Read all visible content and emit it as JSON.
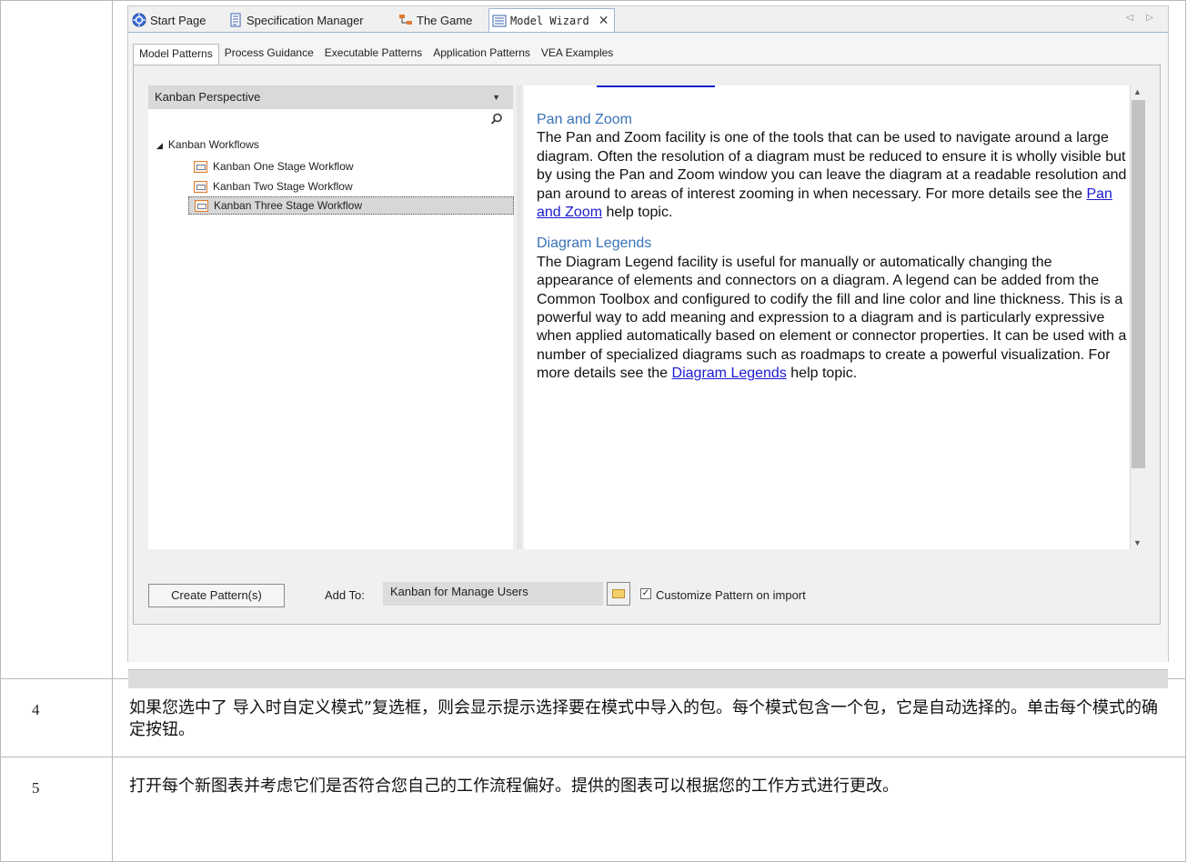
{
  "tabs": [
    {
      "label": "Start Page",
      "icon": "start-page-icon"
    },
    {
      "label": "Specification Manager",
      "icon": "specification-icon"
    },
    {
      "label": "The Game",
      "icon": "diagram-icon"
    },
    {
      "label": "Model Wizard",
      "icon": "model-wizard-icon",
      "active": true
    }
  ],
  "subtabs": [
    "Model Patterns",
    "Process Guidance",
    "Executable Patterns",
    "Application Patterns",
    "VEA Examples"
  ],
  "perspective": "Kanban Perspective",
  "tree": {
    "root": "Kanban Workflows",
    "items": [
      "Kanban One Stage Workflow",
      "Kanban Two Stage Workflow",
      "Kanban Three Stage Workflow"
    ],
    "selected_index": 2
  },
  "help": {
    "pan_title": "Pan and Zoom",
    "pan_text_1": "The Pan and Zoom facility is one of the tools that can be used to navigate around a large diagram. Often the resolution of a diagram must be reduced to ensure it is wholly visible but by using the Pan and Zoom window you can leave the diagram at a readable resolution and pan around to areas of interest zooming in when necessary. For more details see the ",
    "pan_link": "Pan and Zoom",
    "pan_text_2": " help topic.",
    "legend_title": "Diagram Legends",
    "legend_text_1": "The Diagram Legend facility is useful for manually or automatically changing the appearance of elements and connectors on a diagram. A legend can be added from the Common Toolbox and configured to codify the fill and line color and line thickness. This is a powerful way to add meaning and expression to a diagram and is particularly expressive when applied automatically based on element or connector properties. It can be used with a number of specialized diagrams such as roadmaps to create a powerful visualization.  For more details see the ",
    "legend_link": "Diagram Legends",
    "legend_text_2": " help topic."
  },
  "controls": {
    "create_button": "Create Pattern(s)",
    "add_to_label": "Add To:",
    "add_to_value": "Kanban for Manage Users",
    "customize_label": "Customize Pattern on import",
    "customize_checked": true
  },
  "steps": [
    {
      "num": "4",
      "text": "如果您选中了 导入时自定义模式”复选框，则会显示提示选择要在模式中导入的包。每个模式包含一个包，它是自动选择的。单击每个模式的确定按钮。"
    },
    {
      "num": "5",
      "text": "打开每个新图表并考虑它们是否符合您自己的工作流程偏好。提供的图表可以根据您的工作方式进行更改。"
    }
  ]
}
